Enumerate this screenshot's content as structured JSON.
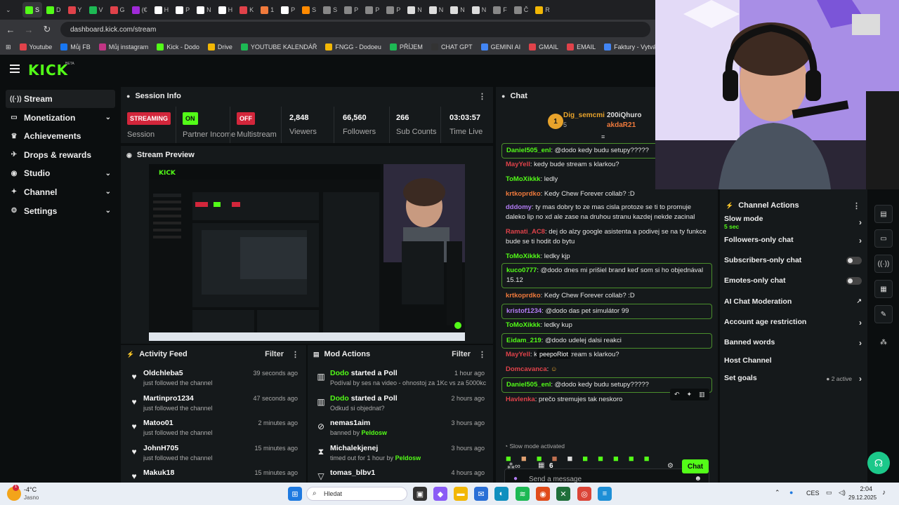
{
  "browser": {
    "tabs": [
      "S",
      "D",
      "Y",
      "V",
      "G",
      "(€",
      "H",
      "P",
      "N",
      "H",
      "K",
      "1",
      "P",
      "S",
      "S",
      "P",
      "P",
      "P",
      "N",
      "N",
      "N",
      "N",
      "F",
      "Č",
      "R"
    ],
    "active_tab_index": 0,
    "url": "dashboard.kick.com/stream",
    "bookmarks": [
      "Youtube",
      "Můj FB",
      "Můj instagram",
      "Kick - Dodo",
      "Drive",
      "YOUTUBE KALENDÁŘ",
      "FNGG - Dodoeu",
      "PŘÍJEM",
      "CHAT GPT",
      "GEMINI AI",
      "GMAIL",
      "EMAIL",
      "Faktury - Vytváření",
      "PNG"
    ]
  },
  "kick": {
    "logo": "KICK",
    "beta": "BETA",
    "sidebar": [
      {
        "label": "Stream",
        "icon": "signal-icon",
        "glyph": "((·))",
        "active": true,
        "chevron": false
      },
      {
        "label": "Monetization",
        "icon": "money-icon",
        "glyph": "▭",
        "active": false,
        "chevron": true
      },
      {
        "label": "Achievements",
        "icon": "trophy-icon",
        "glyph": "♛",
        "active": false,
        "chevron": false
      },
      {
        "label": "Drops & rewards",
        "icon": "rocket-icon",
        "glyph": "✈",
        "active": false,
        "chevron": false
      },
      {
        "label": "Studio",
        "icon": "studio-icon",
        "glyph": "◉",
        "active": false,
        "chevron": true
      },
      {
        "label": "Channel",
        "icon": "channel-icon",
        "glyph": "✦",
        "active": false,
        "chevron": true
      },
      {
        "label": "Settings",
        "icon": "gear-icon",
        "glyph": "⚙",
        "active": false,
        "chevron": true
      }
    ],
    "session": {
      "title": "Session Info",
      "streaming_badge": "STREAMING",
      "streaming_label": "Session",
      "partner_badge": "ON",
      "partner_label": "Partner Income",
      "multistream_badge": "OFF",
      "multistream_label": "Multistream",
      "viewers": "2,848",
      "viewers_label": "Viewers",
      "followers": "66,560",
      "followers_label": "Followers",
      "subs": "266",
      "subs_label": "Sub Counts",
      "time": "03:03:57",
      "time_label": "Time Live"
    },
    "preview": {
      "title": "Stream Preview"
    },
    "activity": {
      "title": "Activity Feed",
      "filter": "Filter",
      "items": [
        {
          "name": "Oldchleba5",
          "text": "just followed the channel",
          "time": "39 seconds ago"
        },
        {
          "name": "Martinpro1234",
          "text": "just followed the channel",
          "time": "47 seconds ago"
        },
        {
          "name": "Matoo01",
          "text": "just followed the channel",
          "time": "2 minutes ago"
        },
        {
          "name": "JohnH705",
          "text": "just followed the channel",
          "time": "15 minutes ago"
        },
        {
          "name": "Makuk18",
          "text": "",
          "time": "15 minutes ago"
        }
      ]
    },
    "mod": {
      "title": "Mod Actions",
      "filter": "Filter",
      "items": [
        {
          "icon": "poll-icon",
          "glyph": "▥",
          "name": "Dodo",
          "action": " started a Poll",
          "text": "Podíval by ses na video - ohnostoj za 1Kc vs za 5000kc",
          "by": "",
          "time": "1 hour ago"
        },
        {
          "icon": "poll-icon",
          "glyph": "▥",
          "name": "Dodo",
          "action": " started a Poll",
          "text": "Odkud si objednat?",
          "by": "",
          "time": "2 hours ago"
        },
        {
          "icon": "ban-icon",
          "glyph": "⊘",
          "name": "nemas1aim",
          "action": "",
          "text": "banned by ",
          "by": "Peldosw",
          "time": "3 hours ago"
        },
        {
          "icon": "hourglass-icon",
          "glyph": "⧗",
          "name": "Michalekjenej",
          "action": "",
          "text": "timed out for 1 hour by ",
          "by": "Peldosw",
          "time": "3 hours ago"
        },
        {
          "icon": "chevron-down-icon",
          "glyph": "▽",
          "name": "tomas_blbv1",
          "action": "",
          "text": "",
          "by": "",
          "time": "4 hours ago"
        }
      ]
    },
    "chat": {
      "title": "Chat",
      "top_gifters": [
        {
          "rank": "1",
          "name": "Dig_semcmi",
          "count": "5"
        },
        {
          "name": "200iQhuro"
        },
        {
          "name": "akdaR21"
        }
      ],
      "messages": [
        {
          "user": "Daniel505_enl",
          "color": "#53fc18",
          "text": "@dodo kedy budu setupy?????",
          "hl": true
        },
        {
          "user": "MayYell",
          "color": "#e0424a",
          "text": "kedy bude stream s klarkou?",
          "hl": false
        },
        {
          "user": "ToMoXikkk",
          "color": "#53fc18",
          "text": "ledly",
          "hl": false
        },
        {
          "user": "krtkoprdko",
          "color": "#f07a3c",
          "text": "Kedy Chew Forever collab? :D",
          "hl": false
        },
        {
          "user": "dddomy",
          "color": "#b37cf5",
          "text": "ty mas dobry to ze mas cisla protoze se ti to promuje daleko lip no xd ale zase na druhou stranu kazdej nekde zacinal",
          "hl": false
        },
        {
          "user": "Ramati_AC8",
          "color": "#e0424a",
          "text": "dej do alzy google asistenta a podivej se na ty funkce bude se ti hodit do bytu",
          "hl": false
        },
        {
          "user": "ToMoXikkk",
          "color": "#53fc18",
          "text": "ledky kjp",
          "hl": false
        },
        {
          "user": "kuco0777",
          "color": "#53fc18",
          "text": "@dodo dnes mi prišiel brand keď som si ho objednával 15.12",
          "hl": true
        },
        {
          "user": "krtkoprdko",
          "color": "#f07a3c",
          "text": "Kedy Chew Forever collab? :D",
          "hl": false
        },
        {
          "user": "kristof1234",
          "color": "#b37cf5",
          "text": "@dodo das pet simulátor 99",
          "hl": true
        },
        {
          "user": "ToMoXikkk",
          "color": "#53fc18",
          "text": "ledky kup",
          "hl": false
        },
        {
          "user": "Eidam_219",
          "color": "#53fc18",
          "text": "@dodo udelej dalsi reakci",
          "hl": true
        },
        {
          "user": "MayYell",
          "color": "#e0424a",
          "text": "kedy bude stream s klarkou?",
          "hl": false
        },
        {
          "user": "Domcavanca",
          "color": "#e0424a",
          "text": "",
          "hl": false
        },
        {
          "user": "Daniel505_enl",
          "color": "#53fc18",
          "text": "@dodo kedy budu setupy?????",
          "hl": true
        },
        {
          "user": "Havlenka",
          "color": "#e0424a",
          "text": "prečo stremujes tak neskoro",
          "hl": false
        }
      ],
      "tooltip": "peepoRiot",
      "slow_notice": "Slow mode activated",
      "placeholder": "Send a message",
      "count": "6",
      "send": "Chat"
    },
    "channel_actions": {
      "title": "Channel Actions",
      "items": [
        {
          "label": "Slow mode",
          "sub": "5 sec",
          "type": "chevron"
        },
        {
          "label": "Followers-only chat",
          "sub": "",
          "type": "chevron"
        },
        {
          "label": "Subscribers-only chat",
          "sub": "",
          "type": "toggle"
        },
        {
          "label": "Emotes-only chat",
          "sub": "",
          "type": "toggle"
        },
        {
          "label": "AI Chat Moderation",
          "sub": "",
          "type": "external"
        },
        {
          "label": "Account age restriction",
          "sub": "",
          "type": "chevron"
        },
        {
          "label": "Banned words",
          "sub": "",
          "type": "chevron"
        },
        {
          "label": "Host Channel",
          "sub": "",
          "type": "none"
        },
        {
          "label": "Set goals",
          "sub": "2 active",
          "type": "chevron-status"
        }
      ]
    }
  },
  "taskbar": {
    "weather_temp": "-4°C",
    "weather_text": "Jasno",
    "search": "Hledat",
    "lang": "CES",
    "time": "2:04",
    "date": "29.12.2025"
  }
}
